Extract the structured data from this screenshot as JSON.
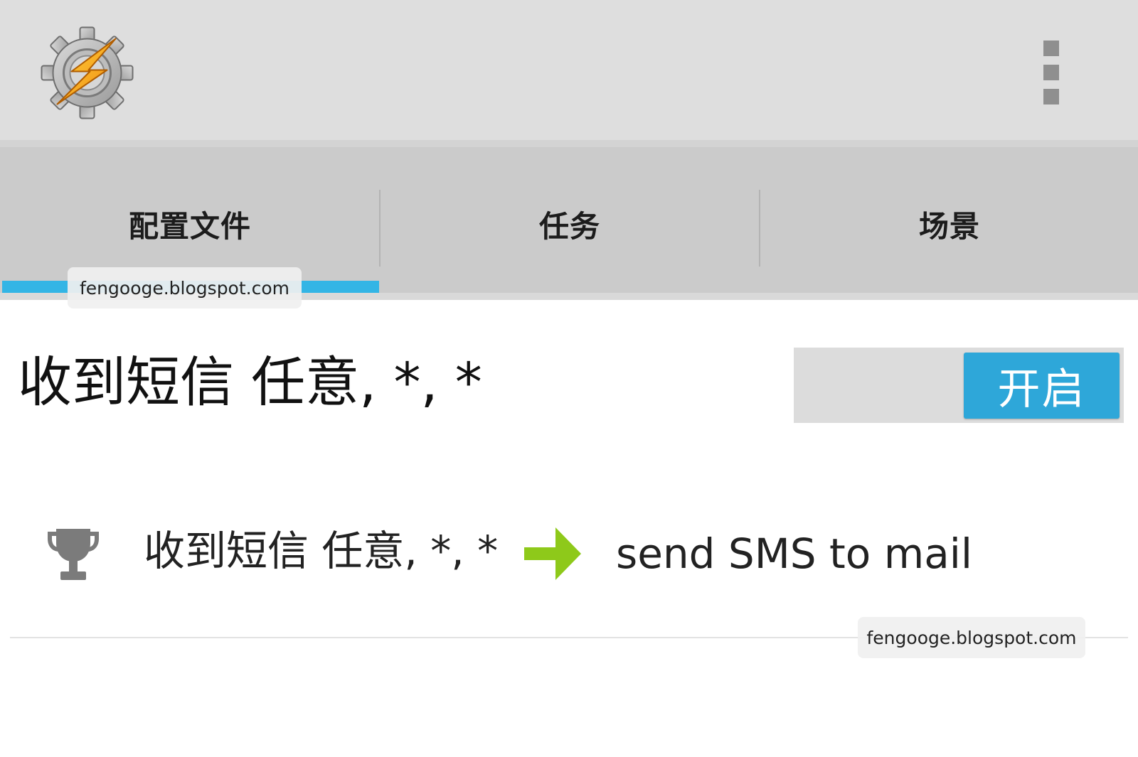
{
  "app_bar": {
    "logo_icon": "tasker-gear-lightning-icon",
    "menu_icon": "overflow-menu-icon"
  },
  "tabs": [
    {
      "label": "配置文件",
      "selected": true
    },
    {
      "label": "任务",
      "selected": false
    },
    {
      "label": "场景",
      "selected": false
    }
  ],
  "colors": {
    "tab_indicator": "#33b5e5",
    "toggle_on": "#2ea7d9",
    "arrow": "#8ec91a"
  },
  "watermarks": [
    "fengooge.blogspot.com",
    "fengooge.blogspot.com"
  ],
  "profile": {
    "title": "收到短信 任意, *, *",
    "toggle_label": "开启",
    "enabled": true,
    "context_icon": "trophy-icon",
    "context_text": "收到短信 任意, *, *",
    "link_icon": "arrow-right-icon",
    "task_text": "send SMS to mail"
  }
}
